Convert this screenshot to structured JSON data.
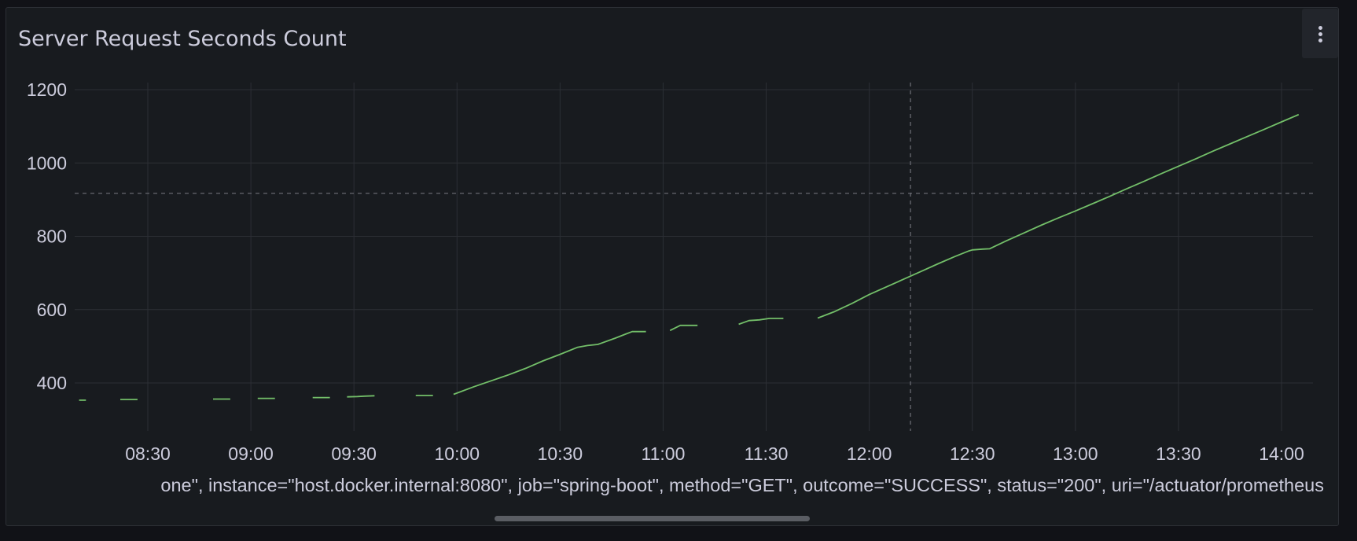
{
  "panel": {
    "title": "Server Request Seconds Count",
    "menu_icon": "vertical-ellipsis-icon"
  },
  "legend": {
    "series_label": "one\", instance=\"host.docker.internal:8080\", job=\"spring-boot\", method=\"GET\", outcome=\"SUCCESS\", status=\"200\", uri=\"/actuator/prometheus",
    "line_color": "#73bf69"
  },
  "colors": {
    "background": "#111217",
    "panel": "#181b1f",
    "grid": "#2c2f35",
    "text": "#ccccdc",
    "series": "#73bf69"
  },
  "chart_data": {
    "type": "line",
    "title": "Server Request Seconds Count",
    "xlabel": "",
    "ylabel": "",
    "x_range": [
      "08:10",
      "14:05"
    ],
    "ylim": [
      300,
      1220
    ],
    "y_ticks": [
      400,
      600,
      800,
      1000,
      1200
    ],
    "y_tick_labels": [
      "400",
      "600",
      "800",
      "1000",
      "1200"
    ],
    "x_ticks": [
      "08:30",
      "09:00",
      "09:30",
      "10:00",
      "10:30",
      "11:00",
      "11:30",
      "12:00",
      "12:30",
      "13:00",
      "13:30",
      "14:00"
    ],
    "grid": true,
    "crosshair": {
      "x": "12:12",
      "y": 917
    },
    "series": [
      {
        "color": "#73bf69",
        "segments": [
          [
            [
              "08:10",
              353
            ],
            [
              "08:12",
              353
            ]
          ],
          [
            [
              "08:22",
              355
            ],
            [
              "08:27",
              355
            ]
          ],
          [
            [
              "08:49",
              356
            ],
            [
              "08:54",
              356
            ]
          ],
          [
            [
              "09:02",
              358
            ],
            [
              "09:07",
              358
            ]
          ],
          [
            [
              "09:18",
              360
            ],
            [
              "09:23",
              360
            ]
          ],
          [
            [
              "09:28",
              362
            ],
            [
              "09:31",
              363
            ],
            [
              "09:33",
              364
            ],
            [
              "09:36",
              365
            ]
          ],
          [
            [
              "09:48",
              366
            ],
            [
              "09:53",
              366
            ]
          ],
          [
            [
              "09:59",
              369
            ],
            [
              "10:05",
              390
            ],
            [
              "10:10",
              406
            ],
            [
              "10:15",
              422
            ],
            [
              "10:20",
              440
            ],
            [
              "10:25",
              460
            ],
            [
              "10:30",
              478
            ],
            [
              "10:35",
              497
            ],
            [
              "10:38",
              502
            ],
            [
              "10:41",
              505
            ],
            [
              "10:46",
              522
            ],
            [
              "10:49",
              533
            ],
            [
              "10:51",
              540
            ],
            [
              "10:55",
              540
            ]
          ],
          [
            [
              "11:02",
              543
            ],
            [
              "11:05",
              557
            ],
            [
              "11:10",
              557
            ]
          ],
          [
            [
              "11:22",
              560
            ],
            [
              "11:25",
              570
            ],
            [
              "11:28",
              572
            ],
            [
              "11:31",
              576
            ],
            [
              "11:35",
              576
            ]
          ],
          [
            [
              "11:45",
              577
            ],
            [
              "11:50",
              595
            ],
            [
              "11:55",
              617
            ],
            [
              "12:00",
              641
            ],
            [
              "12:05",
              662
            ],
            [
              "12:10",
              683
            ],
            [
              "12:15",
              704
            ],
            [
              "12:20",
              725
            ],
            [
              "12:25",
              745
            ],
            [
              "12:29",
              760
            ],
            [
              "12:30",
              763
            ],
            [
              "12:33",
              765
            ],
            [
              "12:35",
              766
            ],
            [
              "12:40",
              788
            ],
            [
              "12:45",
              809
            ],
            [
              "12:50",
              830
            ],
            [
              "12:55",
              850
            ],
            [
              "13:00",
              869
            ],
            [
              "13:05",
              889
            ],
            [
              "13:10",
              909
            ],
            [
              "13:15",
              930
            ],
            [
              "13:20",
              950
            ],
            [
              "13:25",
              971
            ],
            [
              "13:30",
              991
            ],
            [
              "13:35",
              1011
            ],
            [
              "13:40",
              1032
            ],
            [
              "13:45",
              1052
            ],
            [
              "13:50",
              1072
            ],
            [
              "13:55",
              1092
            ],
            [
              "14:00",
              1112
            ],
            [
              "14:05",
              1132
            ]
          ]
        ]
      }
    ]
  }
}
